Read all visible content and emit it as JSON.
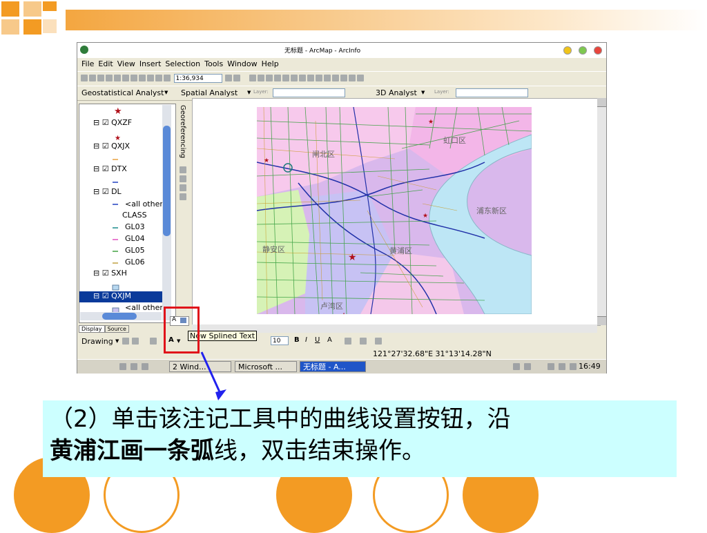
{
  "window": {
    "title": "无标题 - ArcMap - ArcInfo"
  },
  "menu": [
    "File",
    "Edit",
    "View",
    "Insert",
    "Selection",
    "Tools",
    "Window",
    "Help"
  ],
  "toolbar": {
    "scale": "1:36,934"
  },
  "toolbar2": {
    "geostat": "Geostatistical Analyst",
    "spatial": "Spatial Analyst",
    "layers1": "Layer:",
    "analyst3d": "3D Analyst",
    "layers2": "Layer:"
  },
  "toc": {
    "layers": [
      {
        "name": "QXZF"
      },
      {
        "name": "QXJX"
      },
      {
        "name": "DTX"
      },
      {
        "name": "DL"
      },
      {
        "name": "SXH"
      },
      {
        "name": "QXJM"
      }
    ],
    "dl_classes": [
      "<all other",
      "CLASS",
      "GL03",
      "GL04",
      "GL05",
      "GL06"
    ],
    "qxjm_item": "<all other",
    "tabs": [
      "Display",
      "Source"
    ]
  },
  "georef_label": "Georeferencing",
  "map": {
    "districts": [
      "闸北区",
      "虹口区",
      "浦东新区",
      "静安区",
      "黄浦区",
      "卢湾区"
    ]
  },
  "drawing": {
    "label": "Drawing",
    "font_size": "10"
  },
  "tooltip": "New Splined Text",
  "status": {
    "coords": "121°27'32.68\"E  31°13'14.28\"N"
  },
  "taskbar": {
    "buttons": [
      "2 Wind...",
      "Microsoft ...",
      "无标题 - A..."
    ],
    "clock": "16:49"
  },
  "caption": {
    "line1": "（2）单击该注记工具中的曲线设置按钮，沿",
    "line2_bold": "黄浦江画一条弧",
    "line2_rest": "线，双击结束操作。"
  },
  "colors": {
    "orange": "#f39b23",
    "caption_bg": "#ccffff",
    "highlight_red": "#e0121a",
    "arrow_blue": "#2222ee"
  }
}
